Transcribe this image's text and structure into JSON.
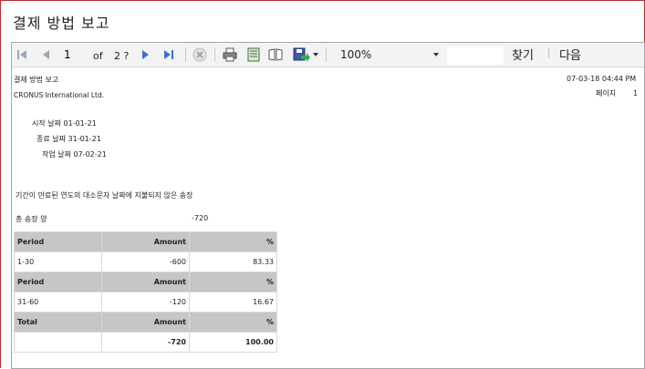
{
  "window": {
    "title": "결제 방법 보고"
  },
  "toolbar": {
    "page_value": "1",
    "of_label": "of",
    "total_pages": "2 ?",
    "zoom": "100%",
    "find_label": "찾기",
    "separator_text": "|",
    "next_label": "다음"
  },
  "report": {
    "title": "결제 방법 보고",
    "company": "CRONUS International Ltd.",
    "date_time": "07-03-18 04:44 PM",
    "page_label": "페이지",
    "page_number": "1",
    "start_date": "시작 날짜 01-01-21",
    "end_date": "종료 날짜 31-01-21",
    "work_date": "작업 날짜 07-02-21",
    "description": "기간이 만료된 연도의 대소문자 날짜에 지불되지 않은 송장",
    "total_label": "총 송장 양",
    "total_value": "-720",
    "table": {
      "rows": [
        {
          "type": "header",
          "cells": [
            "Period",
            "Amount",
            "%"
          ]
        },
        {
          "type": "data",
          "cells": [
            "1-30",
            "-600",
            "83.33"
          ]
        },
        {
          "type": "header",
          "cells": [
            "Period",
            "Amount",
            "%"
          ]
        },
        {
          "type": "data",
          "cells": [
            "31-60",
            "-120",
            "16.67"
          ]
        },
        {
          "type": "header",
          "cells": [
            "Total",
            "Amount",
            "%"
          ]
        },
        {
          "type": "total",
          "cells": [
            "",
            "-720",
            "100.00"
          ]
        }
      ]
    }
  }
}
